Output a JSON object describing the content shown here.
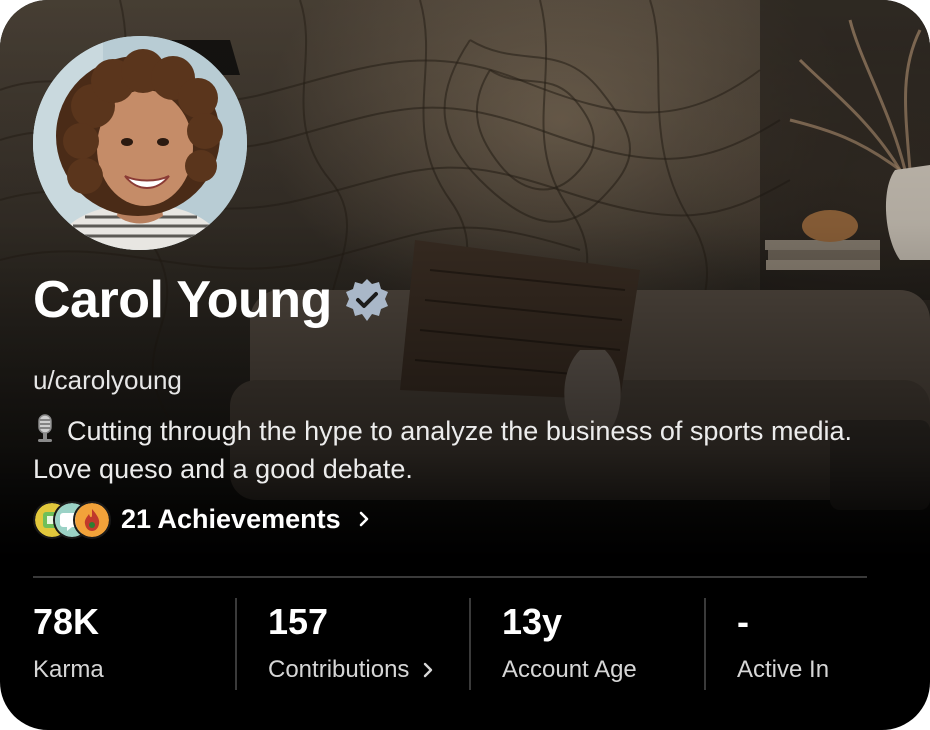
{
  "profile": {
    "display_name": "Carol Young",
    "username": "u/carolyoung",
    "bio_icon": "studio-microphone-icon",
    "bio": "Cutting through the hype to analyze the business of sports media. Love queso and a good debate.",
    "verified_icon": "verified-badge-icon"
  },
  "achievements": {
    "label": "21 Achievements",
    "badge_icons": [
      "achievement-badge-green-icon",
      "achievement-badge-chat-icon",
      "achievement-badge-flame-icon"
    ]
  },
  "stats": [
    {
      "value": "78K",
      "label": "Karma"
    },
    {
      "value": "157",
      "label": "Contributions"
    },
    {
      "value": "13y",
      "label": "Account Age"
    },
    {
      "value": "-",
      "label": "Active In"
    }
  ],
  "colors": {
    "background": "#000000",
    "text": "#ffffff",
    "verified_badge": "#a9b7c8",
    "divider": "#3a3a3a"
  }
}
